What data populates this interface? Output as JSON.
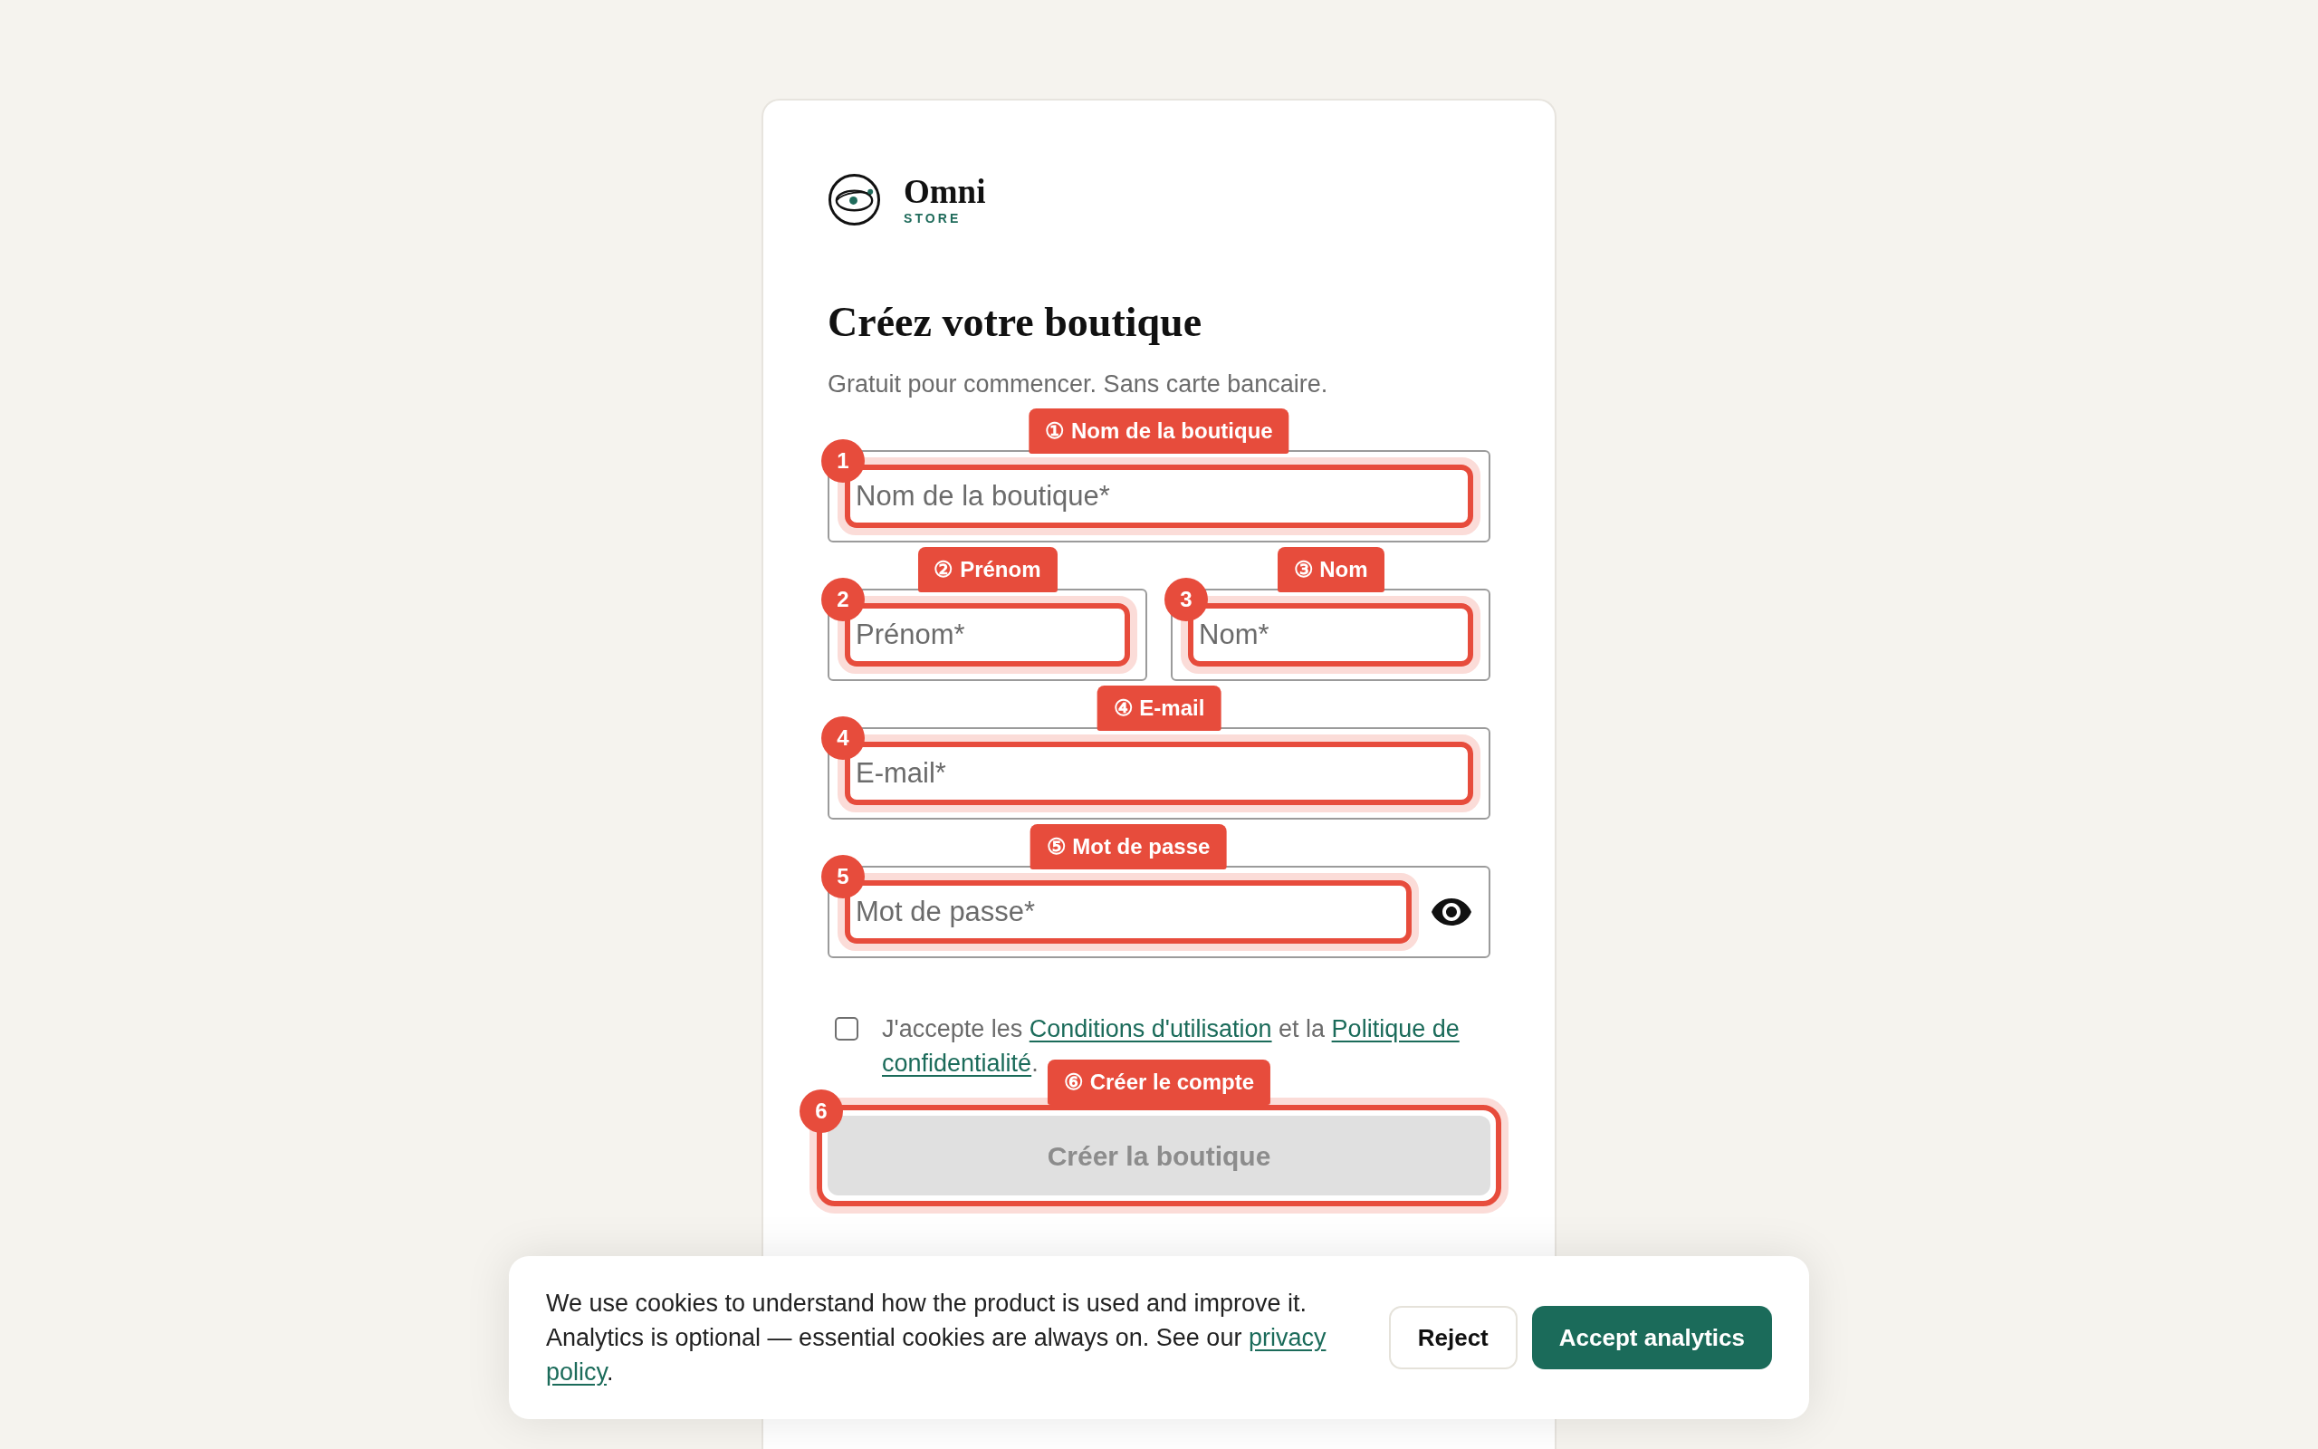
{
  "logo": {
    "name": "Omni",
    "tagline": "STORE"
  },
  "heading": "Créez votre boutique",
  "subtitle": "Gratuit pour commencer. Sans carte bancaire.",
  "form_rows": [
    {
      "fields": [
        {
          "kind": "input",
          "placeholder": "Nom de la boutique*",
          "annotation": {
            "badge": "1",
            "tag": "① Nom de la boutique"
          }
        }
      ]
    },
    {
      "fields": [
        {
          "kind": "input",
          "placeholder": "Prénom*",
          "annotation": {
            "badge": "2",
            "tag": "② Prénom"
          }
        },
        {
          "kind": "input",
          "placeholder": "Nom*",
          "annotation": {
            "badge": "3",
            "tag": "③ Nom"
          }
        }
      ]
    },
    {
      "fields": [
        {
          "kind": "email",
          "placeholder": "E-mail*",
          "annotation": {
            "badge": "4",
            "tag": "④ E-mail"
          }
        }
      ]
    },
    {
      "fields": [
        {
          "kind": "password",
          "placeholder": "Mot de passe*",
          "annotation": {
            "badge": "5",
            "tag": "⑤ Mot de passe"
          }
        }
      ]
    }
  ],
  "consent": {
    "checked": false,
    "text": [
      {
        "kind": "text",
        "text": "J'accepte les "
      },
      {
        "kind": "link",
        "lines": [
          "Conditions d'utilisation"
        ]
      },
      {
        "kind": "text",
        "text": " et la "
      },
      {
        "kind": "link",
        "lines": [
          "Politique de",
          "confidentialité"
        ]
      },
      {
        "kind": "text",
        "text": "."
      }
    ]
  },
  "submit": {
    "label": "Créer la boutique",
    "disabled": true,
    "annotation": {
      "badge": "6",
      "tag": "⑥ Créer le compte"
    }
  },
  "cookie_banner": {
    "text": [
      {
        "kind": "text",
        "text": "We use cookies to understand how the product is used and improve it. Analytics is optional — essential cookies are always on. See our "
      },
      {
        "kind": "link",
        "lines": [
          "privacy",
          "policy"
        ]
      },
      {
        "kind": "text",
        "text": "."
      }
    ],
    "buttons": [
      {
        "kind": "secondary",
        "label": "Reject"
      },
      {
        "kind": "primary",
        "label": "Accept analytics"
      }
    ]
  }
}
